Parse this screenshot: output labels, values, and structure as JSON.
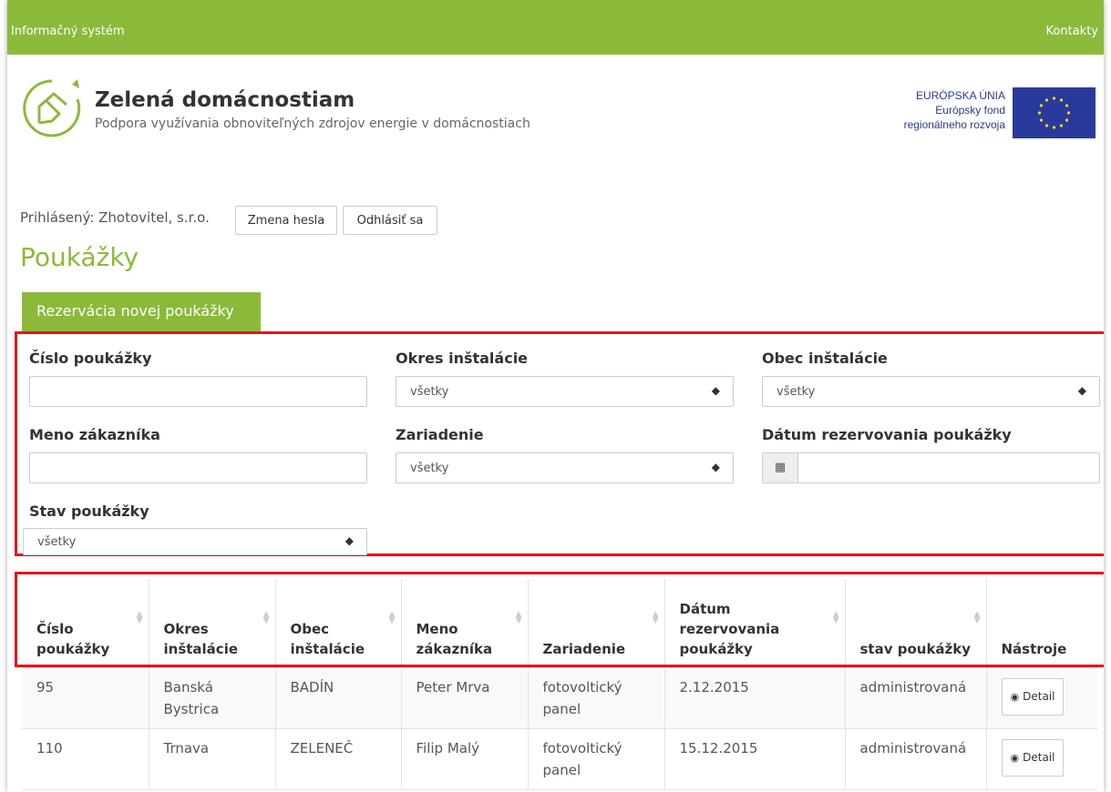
{
  "topbar": {
    "left_label": "Informačný systém",
    "right_link": "Kontakty"
  },
  "header": {
    "title": "Zelená domácnostiam",
    "subtitle": "Podpora využívania obnoviteľných zdrojov energie v domácnostiach",
    "eu_line1": "EURÓPSKA ÚNIA",
    "eu_line2": "Európsky fond",
    "eu_line3": "regionálneho rozvoja"
  },
  "user": {
    "logged_label": "Prihlásený: Zhotovitel, s.r.o.",
    "change_password": "Zmena hesla",
    "logout": "Odhlásiť sa"
  },
  "page": {
    "title": "Poukážky",
    "new_tab": "Rezervácia novej poukážky"
  },
  "filters": {
    "voucher_number_label": "Číslo poukážky",
    "voucher_number_value": "",
    "district_label": "Okres inštalácie",
    "district_value": "všetky",
    "municipality_label": "Obec inštalácie",
    "municipality_value": "všetky",
    "customer_label": "Meno zákazníka",
    "customer_value": "",
    "device_label": "Zariadenie",
    "device_value": "všetky",
    "date_label": "Dátum rezervovania poukážky",
    "date_value": "",
    "status_label": "Stav poukážky",
    "status_value": "všetky"
  },
  "table": {
    "headers": [
      "Číslo poukážky",
      "Okres inštalácie",
      "Obec inštalácie",
      "Meno zákazníka",
      "Zariadenie",
      "Dátum rezervovania poukážky",
      "stav poukážky",
      "Nástroje"
    ],
    "rows": [
      [
        "95",
        "Banská Bystrica",
        "BADÍN",
        "Peter Mrva",
        "fotovoltický panel",
        "2.12.2015",
        "administrovaná",
        "Detail"
      ],
      [
        "110",
        "Trnava",
        "ZELENEČ",
        "Filip Malý",
        "fotovoltický panel",
        "15.12.2015",
        "administrovaná",
        "Detail"
      ]
    ]
  },
  "colors": {
    "brand_green": "#8bba3a",
    "highlight_red": "#e8141a",
    "eu_blue": "#2a3a9c"
  }
}
